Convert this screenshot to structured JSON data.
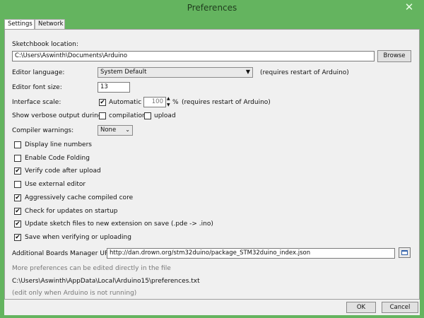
{
  "window": {
    "title": "Preferences",
    "close_glyph": "✕"
  },
  "tabs": [
    {
      "label": "Settings",
      "active": true
    },
    {
      "label": "Network",
      "active": false
    }
  ],
  "sketchbook": {
    "label": "Sketchbook location:",
    "path": "C:\\Users\\Aswinth\\Documents\\Arduino",
    "browse_label": "Browse"
  },
  "editor_language": {
    "label": "Editor language:",
    "value": "System Default",
    "note": "(requires restart of Arduino)"
  },
  "font_size": {
    "label": "Editor font size:",
    "value": "13"
  },
  "interface_scale": {
    "label": "Interface scale:",
    "automatic_label": "Automatic",
    "automatic_checked": true,
    "value": "100",
    "unit": "%",
    "note": "(requires restart of Arduino)"
  },
  "verbose": {
    "label": "Show verbose output during:",
    "compilation_label": "compilation",
    "compilation_checked": false,
    "upload_label": "upload",
    "upload_checked": false
  },
  "compiler_warnings": {
    "label": "Compiler warnings:",
    "value": "None"
  },
  "options": [
    {
      "label": "Display line numbers",
      "checked": false
    },
    {
      "label": "Enable Code Folding",
      "checked": false
    },
    {
      "label": "Verify code after upload",
      "checked": true
    },
    {
      "label": "Use external editor",
      "checked": false
    },
    {
      "label": "Aggressively cache compiled core",
      "checked": true
    },
    {
      "label": "Check for updates on startup",
      "checked": true
    },
    {
      "label": "Update sketch files to new extension on save (.pde -> .ino)",
      "checked": true
    },
    {
      "label": "Save when verifying or uploading",
      "checked": true
    }
  ],
  "boards_manager": {
    "label": "Additional Boards Manager URLs:",
    "url": "http://dan.drown.org/stm32duino/package_STM32duino_index.json"
  },
  "footer_info": {
    "more_prefs": "More preferences can be edited directly in the file",
    "prefs_path": "C:\\Users\\Aswinth\\AppData\\Local\\Arduino15\\preferences.txt",
    "edit_note": "(edit only when Arduino is not running)"
  },
  "buttons": {
    "ok": "OK",
    "cancel": "Cancel"
  },
  "colors": {
    "window_frame": "#64b45f",
    "panel": "#f0f0f0"
  },
  "icons": {
    "url_list_button": "window-list-icon"
  }
}
